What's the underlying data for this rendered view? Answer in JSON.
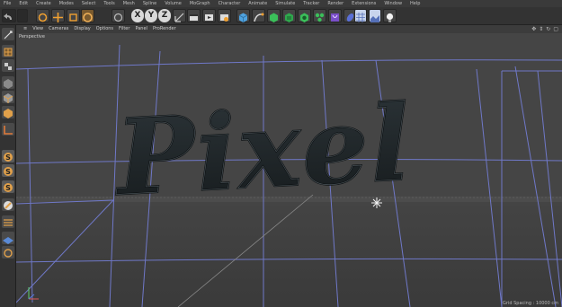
{
  "menu": [
    "File",
    "Edit",
    "Create",
    "Modes",
    "Select",
    "Tools",
    "Mesh",
    "Spline",
    "Volume",
    "MoGraph",
    "Character",
    "Animate",
    "Simulate",
    "Tracker",
    "Render",
    "Extensions",
    "Window",
    "Help"
  ],
  "toolbar": {
    "axis_x": "X",
    "axis_y": "Y",
    "axis_z": "Z"
  },
  "viewport": {
    "menu": [
      "View",
      "Cameras",
      "Display",
      "Options",
      "Filter",
      "Panel",
      "ProRender"
    ],
    "camera_label": "Perspective",
    "scene_text": "Pixel",
    "grid_spacing": "Grid Spacing : 10000 cm"
  },
  "colors": {
    "accent": "#f0a030",
    "grid": "#6f78c8",
    "text_fill": "#1d2326"
  }
}
